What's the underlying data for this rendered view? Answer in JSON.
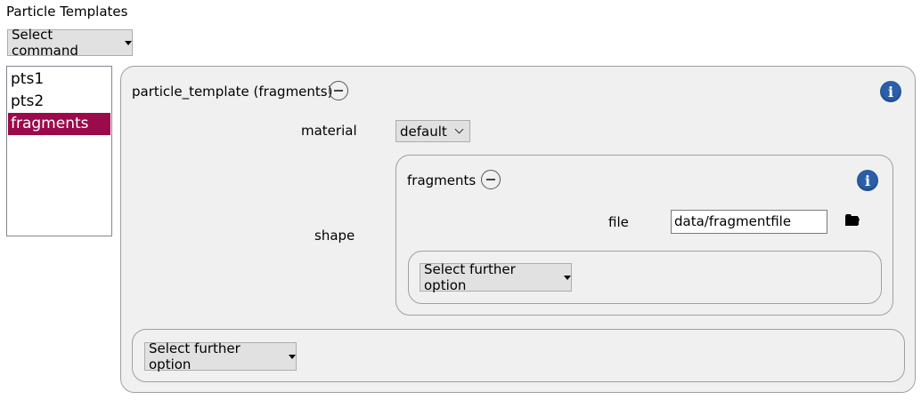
{
  "header": {
    "title": "Particle Templates"
  },
  "command": {
    "label": "Select command"
  },
  "templates": {
    "items": [
      "pts1",
      "pts2",
      "fragments"
    ],
    "selected": "fragments"
  },
  "template": {
    "heading": "particle_template (fragments)",
    "material_label": "material",
    "material_value": "default",
    "shape_label": "shape",
    "shape": {
      "heading": "fragments",
      "file_label": "file",
      "file_value": "data/fragmentfile",
      "option_label": "Select further option"
    },
    "option_label": "Select further option"
  },
  "icons": {
    "info": "info-icon",
    "collapse": "minus-circle-icon",
    "folder": "folder-icon"
  },
  "colors": {
    "selection": "#9b0a4b",
    "info": "#2a5fa8"
  }
}
